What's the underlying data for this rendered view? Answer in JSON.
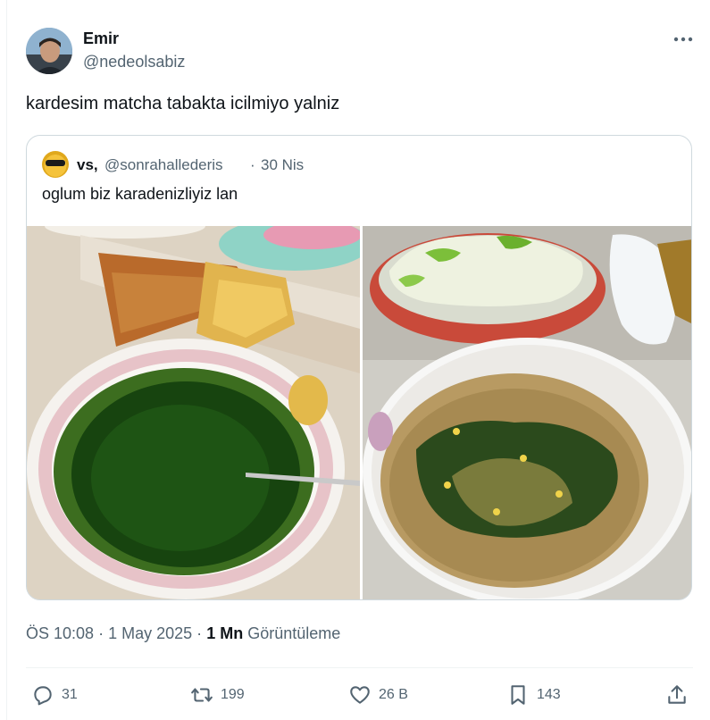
{
  "author": {
    "name": "Emir",
    "handle": "@nedeolsabiz"
  },
  "tweet_text": "kardesim matcha tabakta icilmiyo yalniz",
  "quote": {
    "name": "vs,",
    "handle": "@sonrahallederis",
    "separator": "·",
    "date": "30 Nis",
    "text": "oglum biz karadenizliyiz lan"
  },
  "meta": {
    "time": "ÖS 10:08",
    "sep1": "·",
    "date": "1 May 2025",
    "sep2": "·",
    "views_count": "1 Mn",
    "views_label": "Görüntüleme"
  },
  "actions": {
    "replies": "31",
    "reposts": "199",
    "likes": "26 B",
    "bookmarks": "143"
  },
  "icons": {
    "more": "more-horizontal-icon",
    "reply": "reply-icon",
    "repost": "repost-icon",
    "like": "heart-icon",
    "bookmark": "bookmark-icon",
    "share": "share-icon"
  },
  "colors": {
    "text": "#0f1419",
    "secondary": "#536471",
    "border": "#cfd9de",
    "divider": "#eff3f4"
  }
}
